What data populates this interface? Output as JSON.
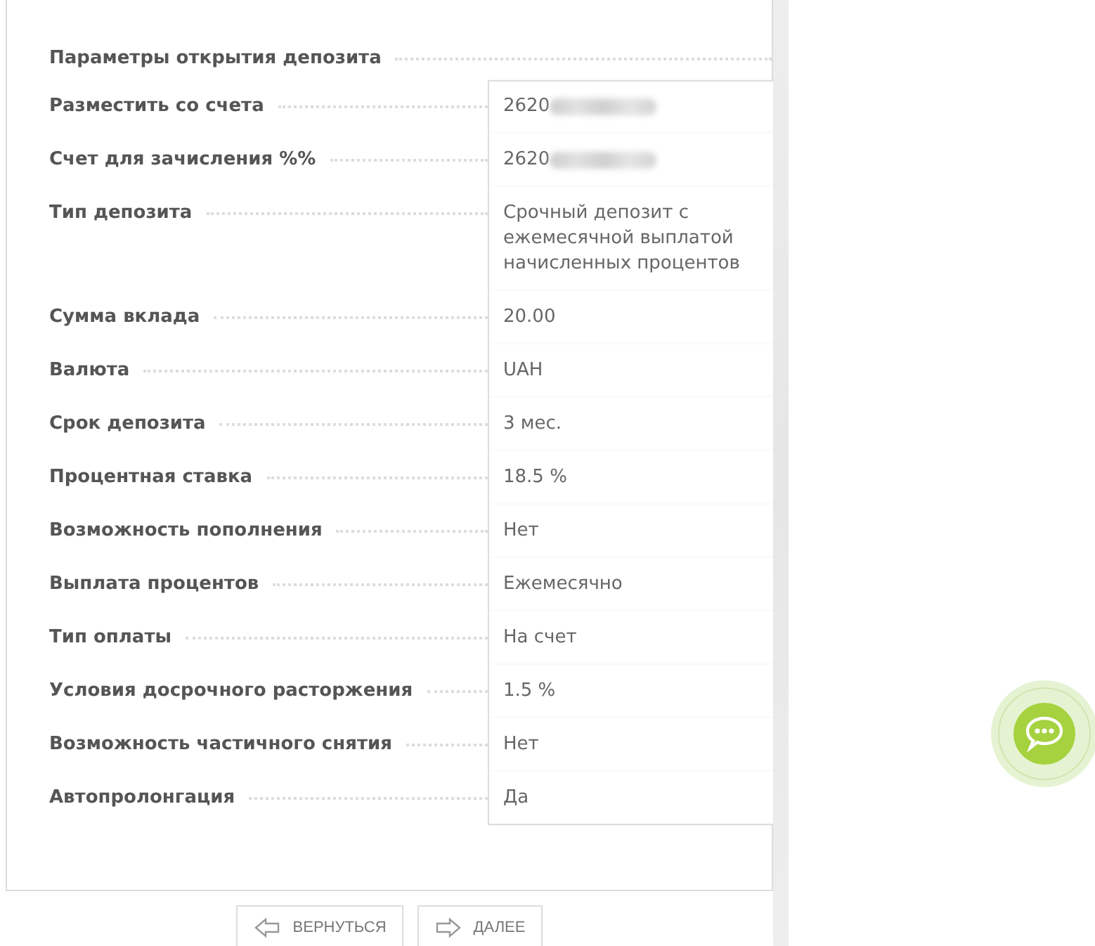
{
  "heading": "Параметры открытия депозита",
  "rows": [
    {
      "label": "Разместить со счета",
      "value": "2620",
      "redacted": true
    },
    {
      "label": "Счет для зачисления %%",
      "value": "2620",
      "redacted": true
    },
    {
      "label": "Тип депозита",
      "value": "Срочный депозит с ежемесячной выплатой начисленных процентов",
      "redacted": false
    },
    {
      "label": "Сумма вклада",
      "value": "20.00",
      "redacted": false
    },
    {
      "label": "Валюта",
      "value": "UAH",
      "redacted": false
    },
    {
      "label": "Срок депозита",
      "value": "3 мес.",
      "redacted": false
    },
    {
      "label": "Процентная ставка",
      "value": "18.5 %",
      "redacted": false
    },
    {
      "label": "Возможность пополнения",
      "value": "Нет",
      "redacted": false
    },
    {
      "label": "Выплата процентов",
      "value": "Ежемесячно",
      "redacted": false
    },
    {
      "label": "Тип оплаты",
      "value": "На счет",
      "redacted": false
    },
    {
      "label": "Условия досрочного расторжения",
      "value": "1.5 %",
      "redacted": false
    },
    {
      "label": "Возможность частичного снятия",
      "value": "Нет",
      "redacted": false
    },
    {
      "label": "Автопролонгация",
      "value": "Да",
      "redacted": false
    }
  ],
  "buttons": [
    {
      "label": "ВЕРНУТЬСЯ",
      "kind": "back"
    },
    {
      "label": "ДАЛЕЕ",
      "kind": "next"
    }
  ]
}
